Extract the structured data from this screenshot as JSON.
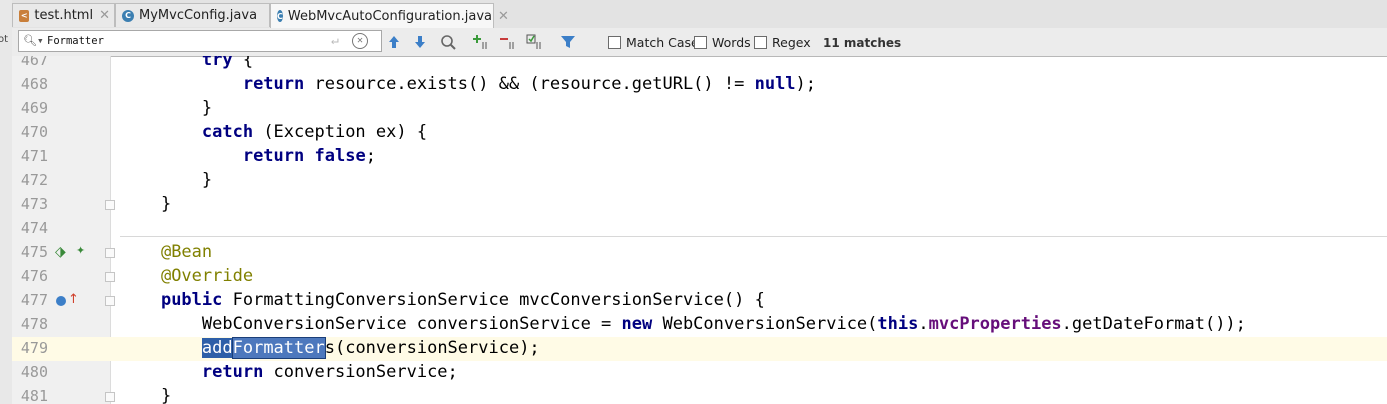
{
  "left_strip_label": "ot",
  "tabs": [
    {
      "label": "test.html",
      "icon": "html-file-icon",
      "active": false
    },
    {
      "label": "MyMvcConfig.java",
      "icon": "java-class-icon",
      "active": false
    },
    {
      "label": "WebMvcAutoConfiguration.java",
      "icon": "java-class-icon",
      "active": true
    }
  ],
  "find": {
    "value": "Formatter",
    "match_case_label": "Match Case",
    "words_label": "Words",
    "regex_label": "Regex",
    "matches": "11 matches"
  },
  "editor": {
    "lines": [
      {
        "num": "467",
        "code": "        try {"
      },
      {
        "num": "468",
        "code": "            return resource.exists() && (resource.getURL() != null);"
      },
      {
        "num": "469",
        "code": "        }"
      },
      {
        "num": "470",
        "code": "        catch (Exception ex) {"
      },
      {
        "num": "471",
        "code": "            return false;"
      },
      {
        "num": "472",
        "code": "        }"
      },
      {
        "num": "473",
        "code": "    }"
      },
      {
        "num": "474",
        "code": ""
      },
      {
        "num": "475",
        "code": "    @Bean"
      },
      {
        "num": "476",
        "code": "    @Override"
      },
      {
        "num": "477",
        "code": "    public FormattingConversionService mvcConversionService() {"
      },
      {
        "num": "478",
        "code": "        WebConversionService conversionService = new WebConversionService(this.mvcProperties.getDateFormat());"
      },
      {
        "num": "479",
        "code": "        addFormatters(conversionService);"
      },
      {
        "num": "480",
        "code": "        return conversionService;"
      },
      {
        "num": "481",
        "code": "    }"
      }
    ],
    "current_line": "479"
  },
  "colors": {
    "keyword": "#000080",
    "annotation": "#808000",
    "field": "#660e7a",
    "search_highlight": "#2e5fa8",
    "current_line": "#fffbe6"
  }
}
